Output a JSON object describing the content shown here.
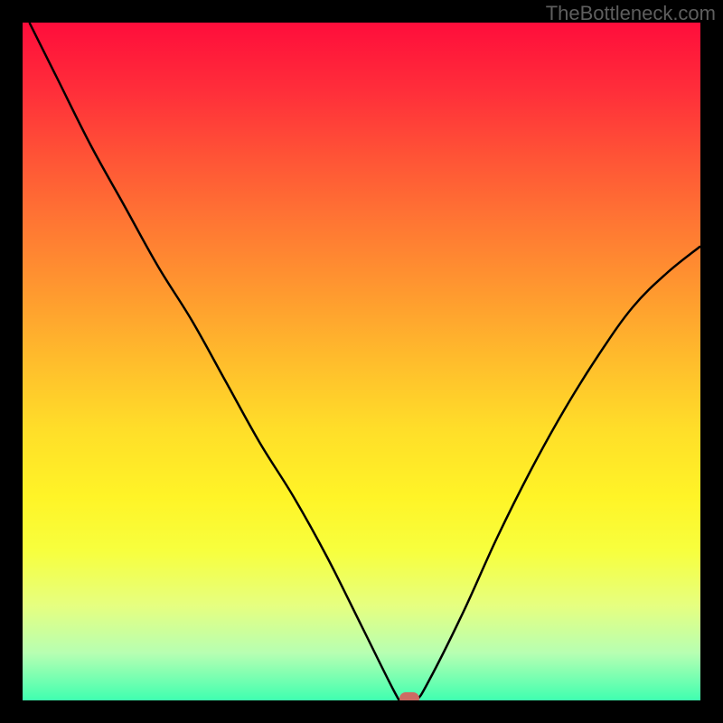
{
  "watermark": "TheBottleneck.com",
  "chart_data": {
    "type": "line",
    "title": "",
    "xlabel": "",
    "ylabel": "",
    "xlim": [
      0,
      100
    ],
    "ylim": [
      0,
      100
    ],
    "grid": false,
    "series": [
      {
        "name": "curve",
        "x": [
          1,
          5,
          10,
          15,
          20,
          25,
          30,
          35,
          40,
          45,
          50,
          55,
          56,
          58,
          60,
          65,
          70,
          75,
          80,
          85,
          90,
          95,
          100
        ],
        "values": [
          100,
          92,
          82,
          73,
          64,
          56,
          47,
          38,
          30,
          21,
          11,
          1,
          0,
          0,
          3,
          13,
          24,
          34,
          43,
          51,
          58,
          63,
          67
        ]
      }
    ],
    "marker": {
      "x": 57,
      "y": 0,
      "color": "#cd6b63"
    },
    "background_gradient": {
      "top_color": "#ff0d3b",
      "mid_color": "#ffde29",
      "bottom_color": "#3fffb0"
    }
  }
}
